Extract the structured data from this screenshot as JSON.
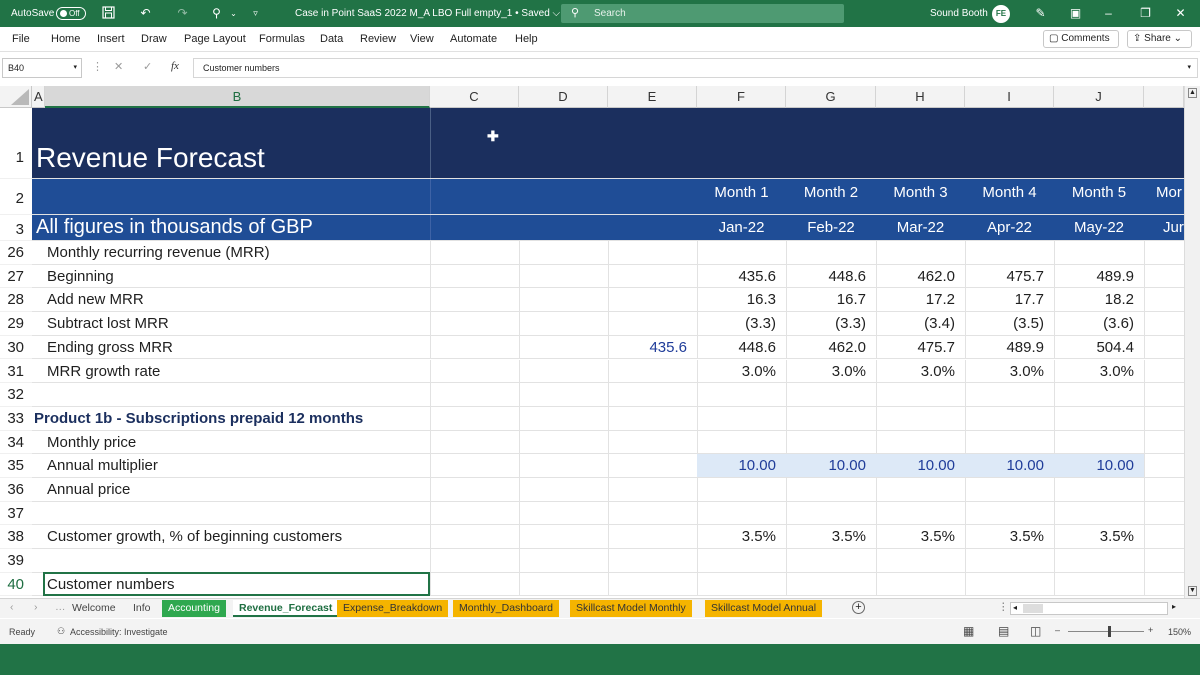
{
  "titlebar": {
    "autosave_label": "AutoSave",
    "autosave_state": "Off",
    "document_title": "Case in Point SaaS 2022 M_A LBO Full empty_1 • Saved ⌵",
    "search_placeholder": "Search",
    "user_name": "Sound Booth",
    "user_initials": "FE"
  },
  "menu": [
    "File",
    "Home",
    "Insert",
    "Draw",
    "Page Layout",
    "Formulas",
    "Data",
    "Review",
    "View",
    "Automate",
    "Help"
  ],
  "comments_label": "Comments",
  "share_label": "Share",
  "formula_bar": {
    "cell_ref": "B40",
    "fx": "fx",
    "content": "Customer numbers"
  },
  "columns": [
    "A",
    "B",
    "C",
    "D",
    "E",
    "F",
    "G",
    "H",
    "I",
    "J"
  ],
  "sheet": {
    "title": "Revenue Forecast",
    "months": [
      "Month 1",
      "Month 2",
      "Month 3",
      "Month 4",
      "Month 5",
      "Mor"
    ],
    "dates": [
      "Jan-22",
      "Feb-22",
      "Mar-22",
      "Apr-22",
      "May-22",
      "Jur"
    ],
    "units_note": "All figures in thousands of GBP",
    "rows": [
      {
        "num": "26",
        "label": "Monthly recurring revenue (MRR)",
        "e": "",
        "values": [
          "",
          "",
          "",
          "",
          ""
        ]
      },
      {
        "num": "27",
        "label": "Beginning",
        "e": "",
        "values": [
          "435.6",
          "448.6",
          "462.0",
          "475.7",
          "489.9"
        ]
      },
      {
        "num": "28",
        "label": "Add new MRR",
        "e": "",
        "values": [
          "16.3",
          "16.7",
          "17.2",
          "17.7",
          "18.2"
        ]
      },
      {
        "num": "29",
        "label": "Subtract lost MRR",
        "e": "",
        "values": [
          "(3.3)",
          "(3.3)",
          "(3.4)",
          "(3.5)",
          "(3.6)"
        ]
      },
      {
        "num": "30",
        "label": "Ending gross MRR",
        "e": "435.6",
        "values": [
          "448.6",
          "462.0",
          "475.7",
          "489.9",
          "504.4"
        ]
      },
      {
        "num": "31",
        "label": "MRR growth rate",
        "e": "",
        "values": [
          "3.0%",
          "3.0%",
          "3.0%",
          "3.0%",
          "3.0%"
        ]
      },
      {
        "num": "32",
        "label": "",
        "e": "",
        "values": [
          "",
          "",
          "",
          "",
          ""
        ]
      },
      {
        "num": "33",
        "label": "Product 1b - Subscriptions prepaid 12 months",
        "e": "",
        "values": [
          "",
          "",
          "",
          "",
          ""
        ]
      },
      {
        "num": "34",
        "label": "Monthly price",
        "e": "",
        "values": [
          "",
          "",
          "",
          "",
          ""
        ]
      },
      {
        "num": "35",
        "label": "Annual multiplier",
        "e": "",
        "values": [
          "10.00",
          "10.00",
          "10.00",
          "10.00",
          "10.00"
        ]
      },
      {
        "num": "36",
        "label": "Annual price",
        "e": "",
        "values": [
          "",
          "",
          "",
          "",
          ""
        ]
      },
      {
        "num": "37",
        "label": "",
        "e": "",
        "values": [
          "",
          "",
          "",
          "",
          ""
        ]
      },
      {
        "num": "38",
        "label": "Customer growth, % of beginning customers",
        "e": "",
        "values": [
          "3.5%",
          "3.5%",
          "3.5%",
          "3.5%",
          "3.5%"
        ]
      },
      {
        "num": "39",
        "label": "",
        "e": "",
        "values": [
          "",
          "",
          "",
          "",
          ""
        ]
      },
      {
        "num": "40",
        "label": "Customer numbers",
        "e": "",
        "values": [
          "",
          "",
          "",
          "",
          ""
        ]
      }
    ]
  },
  "tabs": [
    {
      "label": "Welcome",
      "style": "plain"
    },
    {
      "label": "Info",
      "style": "plain"
    },
    {
      "label": "Accounting",
      "style": "green"
    },
    {
      "label": "Revenue_Forecast",
      "style": "active"
    },
    {
      "label": "Expense_Breakdown",
      "style": "orange"
    },
    {
      "label": "Monthly_Dashboard",
      "style": "orange"
    },
    {
      "label": "Skillcast Model Monthly",
      "style": "orange"
    },
    {
      "label": "Skillcast Model Annual",
      "style": "orange"
    }
  ],
  "status": {
    "ready": "Ready",
    "accessibility": "Accessibility: Investigate",
    "zoom": "150%"
  },
  "colors": {
    "excel_green": "#217346",
    "header_dark_navy": "#1b2f5e",
    "header_blue": "#1f4d96",
    "input_blue_text": "#1f3c99",
    "input_fill": "#dde9f7",
    "tab_orange": "#f5b400",
    "tab_green": "#2fa84f"
  }
}
